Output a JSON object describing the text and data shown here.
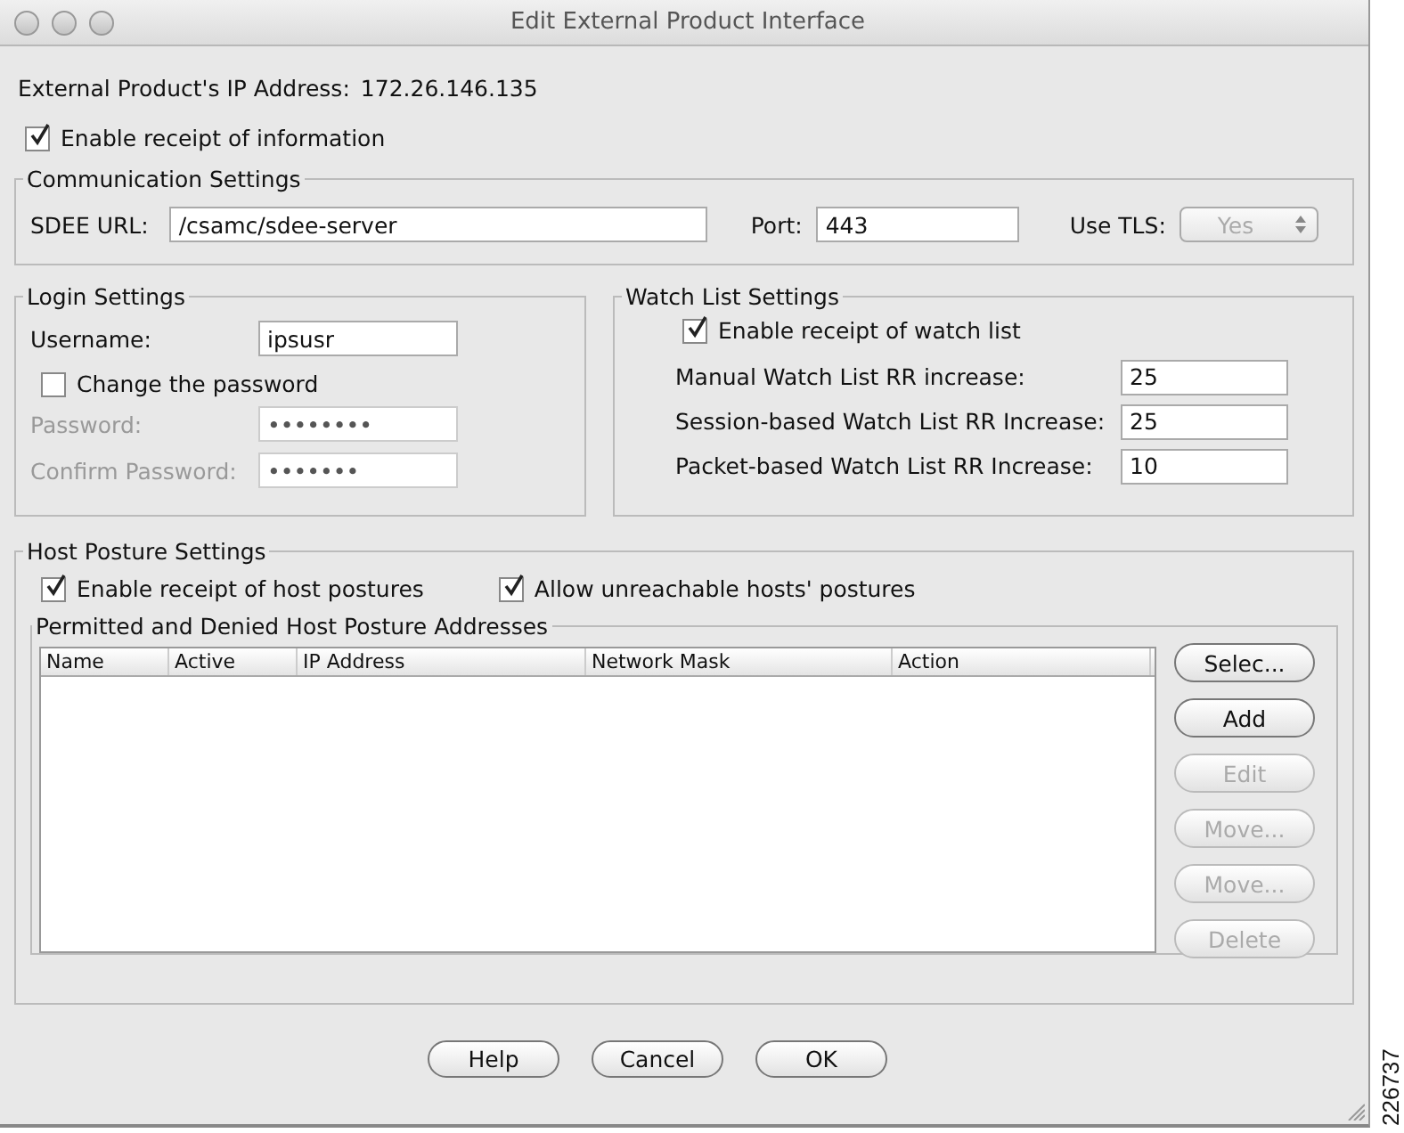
{
  "window": {
    "title": "Edit External Product Interface"
  },
  "ip_address": {
    "label": "External Product's IP Address:",
    "value": "172.26.146.135"
  },
  "enable_receipt": {
    "label": "Enable receipt of information",
    "checked": true
  },
  "communication": {
    "title": "Communication Settings",
    "sdee_url": {
      "label": "SDEE URL:",
      "value": "/csamc/sdee-server"
    },
    "port": {
      "label": "Port:",
      "value": "443"
    },
    "use_tls": {
      "label": "Use TLS:",
      "value": "Yes",
      "disabled": true
    }
  },
  "login": {
    "title": "Login Settings",
    "username": {
      "label": "Username:",
      "value": "ipsusr"
    },
    "change_password": {
      "label": "Change the password",
      "checked": false
    },
    "fields": [
      {
        "label": "Password:",
        "value": "••••••••",
        "disabled": true
      },
      {
        "label": "Confirm Password:",
        "value": "•••••••",
        "disabled": true
      }
    ]
  },
  "watch_list": {
    "title": "Watch List Settings",
    "enable": {
      "label": "Enable receipt of watch list",
      "checked": true
    },
    "fields": [
      {
        "label": "Manual Watch List RR increase:",
        "value": "25"
      },
      {
        "label": "Session-based Watch List RR Increase:",
        "value": "25"
      },
      {
        "label": "Packet-based Watch List RR Increase:",
        "value": "10"
      }
    ]
  },
  "host_posture": {
    "title": "Host Posture Settings",
    "options": [
      {
        "label": "Enable receipt of host postures",
        "checked": true
      },
      {
        "label": "Allow unreachable hosts' postures",
        "checked": true
      }
    ],
    "addresses": {
      "title": "Permitted and Denied Host Posture Addresses",
      "table": {
        "columns": [
          "Name",
          "Active",
          "IP Address",
          "Network Mask",
          "Action"
        ]
      },
      "buttons": [
        {
          "label": "Selec...",
          "disabled": false
        },
        {
          "label": "Add",
          "disabled": false
        },
        {
          "label": "Edit",
          "disabled": true
        },
        {
          "label": "Move...",
          "disabled": true
        },
        {
          "label": "Move...",
          "disabled": true
        },
        {
          "label": "Delete",
          "disabled": true
        }
      ]
    }
  },
  "buttons": [
    "Help",
    "Cancel",
    "OK"
  ],
  "figure_number": "226737"
}
